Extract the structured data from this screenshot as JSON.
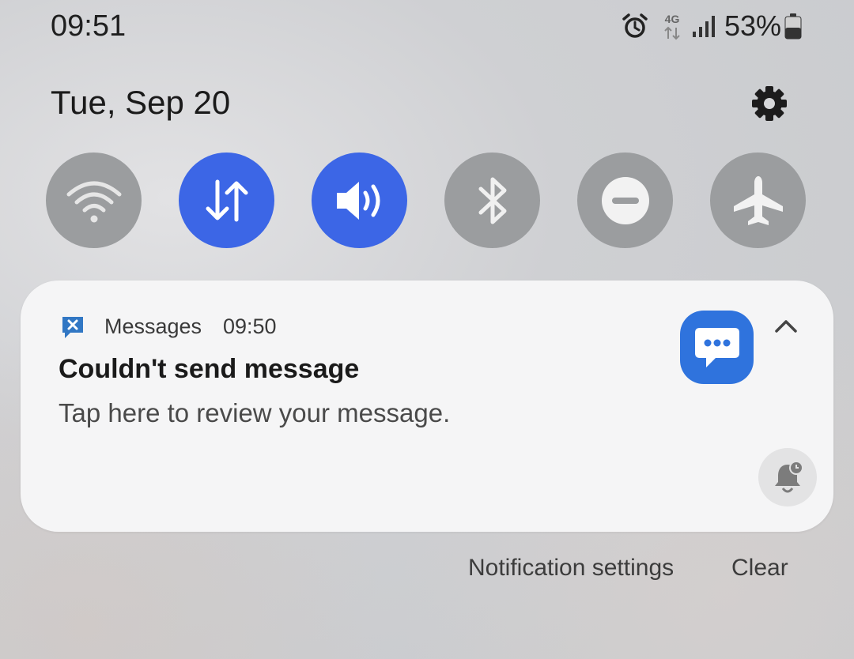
{
  "status_bar": {
    "time": "09:51",
    "network_type": "4G",
    "battery_percent": "53%"
  },
  "shade": {
    "date": "Tue, Sep 20",
    "icons": {
      "settings": "gear-icon"
    }
  },
  "quick_settings": [
    {
      "name": "wifi",
      "icon": "wifi-icon",
      "active": false
    },
    {
      "name": "mobile-data",
      "icon": "data-transfer-icon",
      "active": true
    },
    {
      "name": "sound",
      "icon": "volume-icon",
      "active": true
    },
    {
      "name": "bluetooth",
      "icon": "bluetooth-icon",
      "active": false
    },
    {
      "name": "do-not-disturb",
      "icon": "do-not-disturb-icon",
      "active": false
    },
    {
      "name": "airplane-mode",
      "icon": "airplane-icon",
      "active": false
    }
  ],
  "notification": {
    "app_name": "Messages",
    "time": "09:50",
    "title": "Couldn't send message",
    "body": "Tap here to review your message.",
    "icons": {
      "small": "message-error-icon",
      "large": "messages-app-icon",
      "collapse": "chevron-up-icon",
      "snooze": "snooze-bell-icon"
    }
  },
  "footer": {
    "notification_settings": "Notification settings",
    "clear": "Clear"
  },
  "colors": {
    "active_toggle": "#3c66e6",
    "inactive_toggle": "#9b9d9f",
    "messages_blue": "#2f73dd",
    "card_background": "#f5f5f6"
  }
}
